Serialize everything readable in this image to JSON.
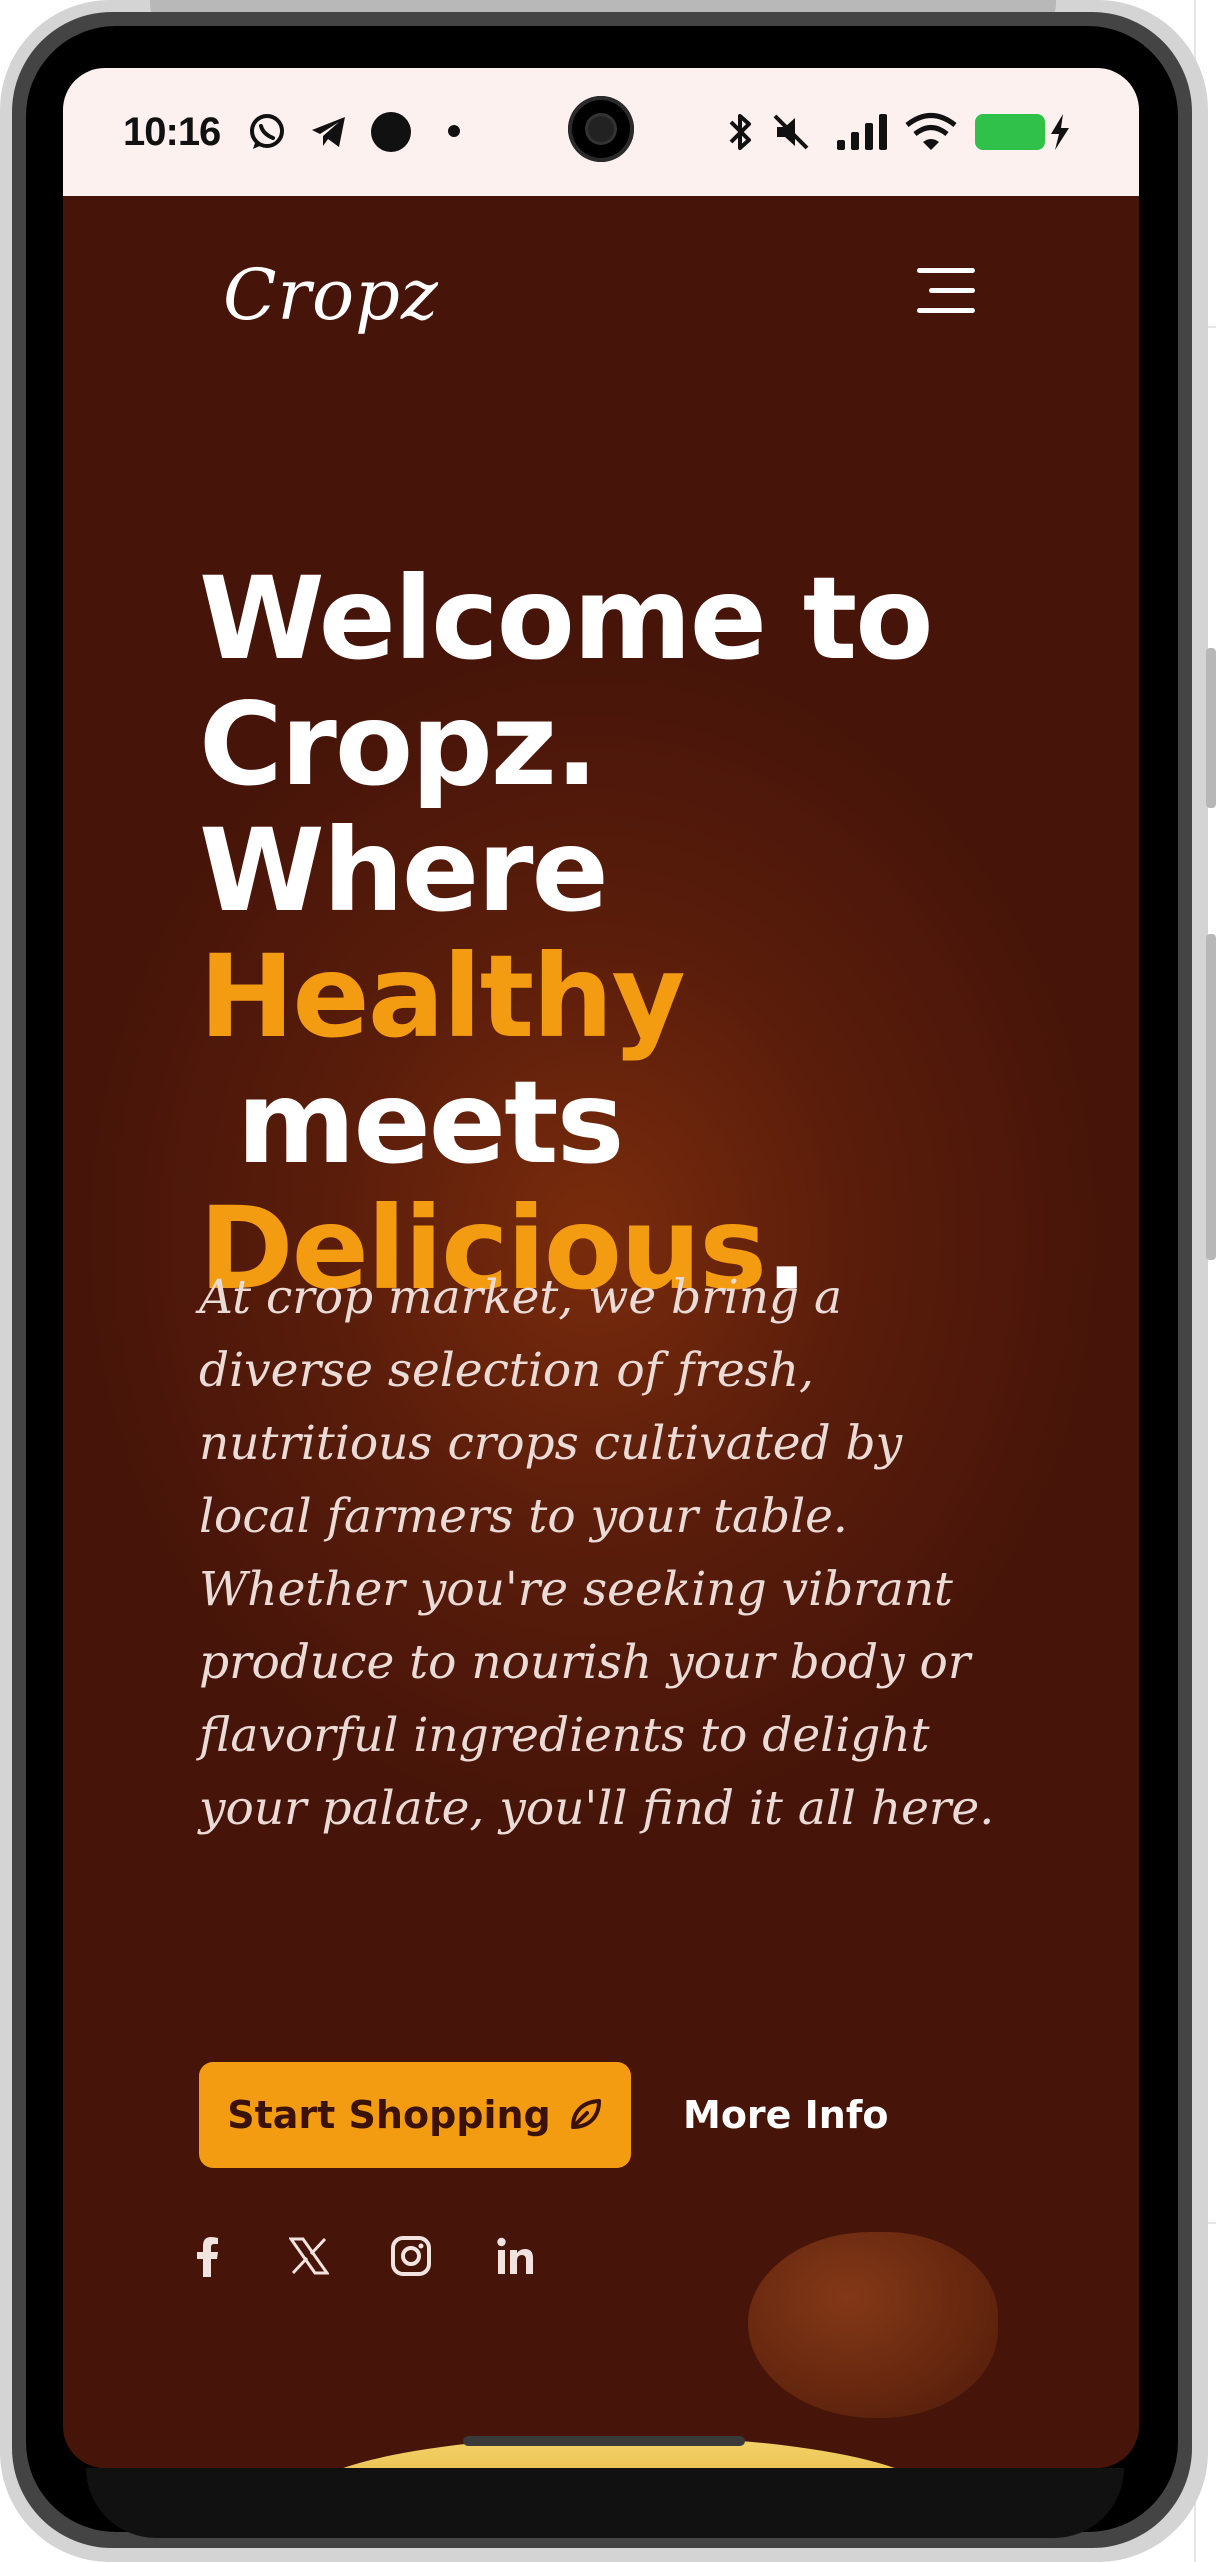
{
  "status_bar": {
    "time": "10:16"
  },
  "header": {
    "logo": "Cropz"
  },
  "hero": {
    "headline_1": "Welcome to",
    "headline_2": "Cropz.",
    "headline_3": "Where",
    "headline_highlight_1": "Healthy",
    "headline_4": " meets",
    "headline_highlight_2": "Delicious",
    "headline_end": ".",
    "description": "At crop market, we bring a diverse selection of fresh, nutritious crops cultivated by local farmers to your table. Whether you're seeking vibrant produce to nourish your body or flavorful ingredients to delight your palate, you'll find it all here.",
    "primary_button": "Start Shopping",
    "secondary_button": "More Info"
  },
  "social": [
    "facebook-icon",
    "x-icon",
    "instagram-icon",
    "linkedin-icon"
  ],
  "colors": {
    "background": "#461409",
    "accent": "#f39c12",
    "text": "#ffffff"
  }
}
